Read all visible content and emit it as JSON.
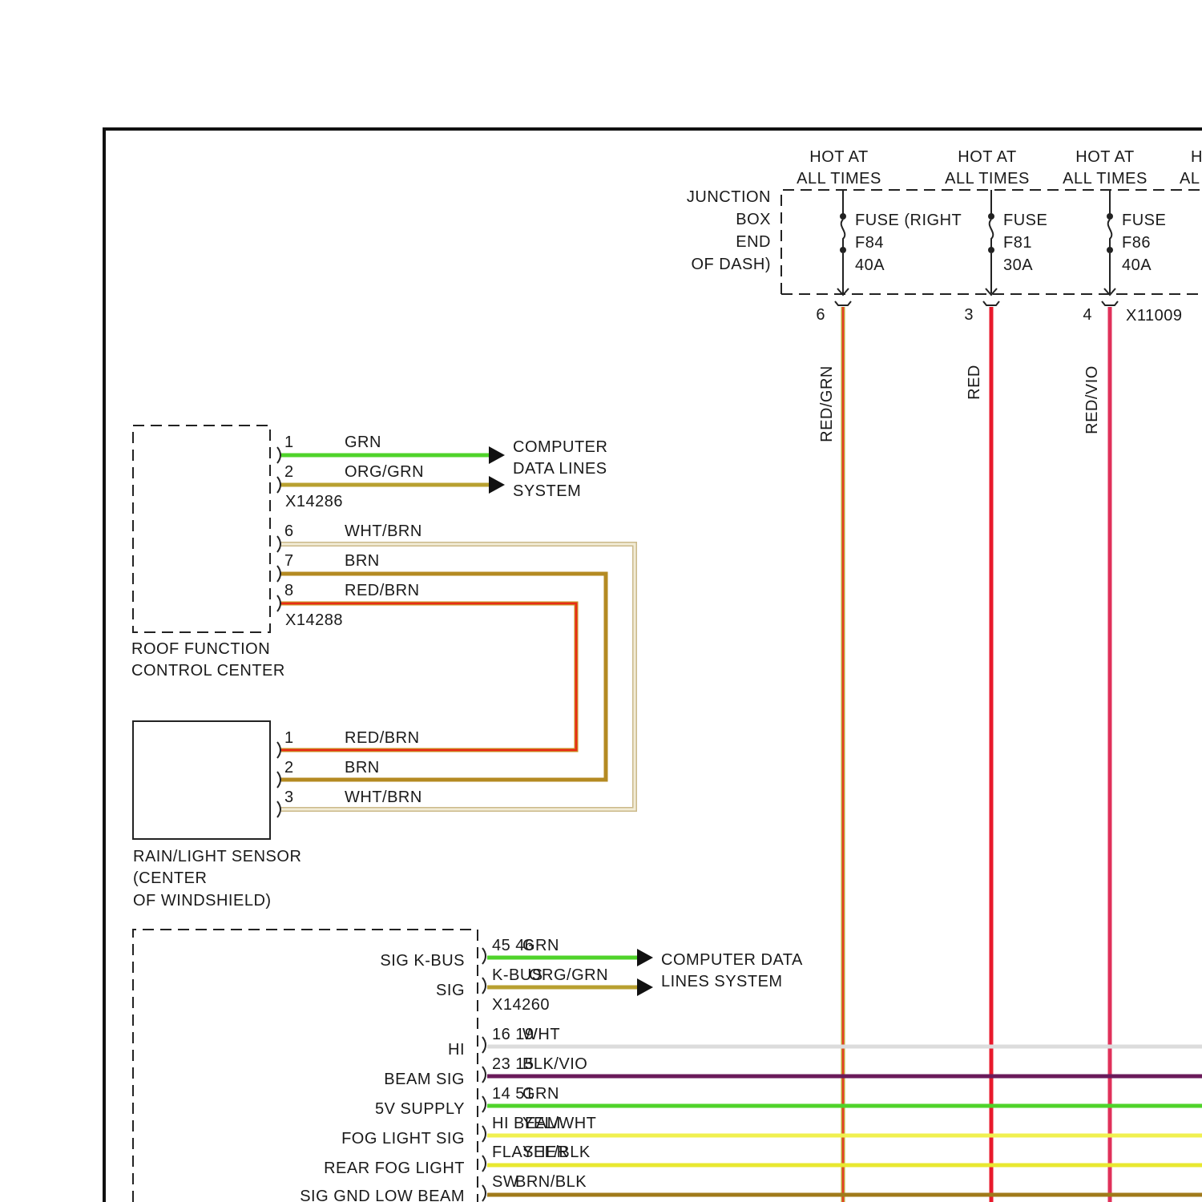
{
  "colors": {
    "GRN": "#4fd32a",
    "ORG/GRN": "#b8a030",
    "WHT/BRN": "#ece3c0",
    "BRN": "#b48a22",
    "RED/BRN": "#e8301a",
    "RED/GRN": "#c88a2a",
    "RED": "#e8192c",
    "RED/VIO": "#e0305a",
    "WHT": "#dcdcdc",
    "BLK/VIO": "#6a1a5a",
    "YEL/WHT": "#f0f050",
    "YEL/BLK": "#e8e830",
    "BRN/BLK": "#a07a1a"
  },
  "junction_box": {
    "label": [
      "JUNCTION",
      "BOX",
      "END",
      "OF DASH)"
    ],
    "connector": "X11009",
    "fuses": [
      {
        "hot": [
          "HOT AT",
          "ALL TIMES"
        ],
        "name": [
          "FUSE (RIGHT",
          "F84",
          "40A"
        ],
        "pin": "6",
        "wire": "RED/GRN"
      },
      {
        "hot": [
          "HOT AT",
          "ALL TIMES"
        ],
        "name": [
          "FUSE",
          "F81",
          "30A"
        ],
        "pin": "3",
        "wire": "RED"
      },
      {
        "hot": [
          "HOT AT",
          "ALL TIMES"
        ],
        "name": [
          "FUSE",
          "F86",
          "40A"
        ],
        "pin": "4",
        "wire": "RED/VIO"
      }
    ],
    "cut_hot": [
      "H",
      "AL"
    ]
  },
  "roof_module": {
    "label": [
      "ROOF FUNCTION",
      "CONTROL CENTER"
    ],
    "connector_a": "X14286",
    "connector_b": "X14288",
    "pins_a": [
      {
        "pin": "1",
        "wire": "GRN"
      },
      {
        "pin": "2",
        "wire": "ORG/GRN"
      }
    ],
    "pins_b": [
      {
        "pin": "6",
        "wire": "WHT/BRN"
      },
      {
        "pin": "7",
        "wire": "BRN"
      },
      {
        "pin": "8",
        "wire": "RED/BRN"
      }
    ],
    "destination": [
      "COMPUTER",
      "DATA LINES",
      "SYSTEM"
    ]
  },
  "rain_sensor": {
    "label": [
      "RAIN/LIGHT SENSOR",
      "(CENTER",
      "OF WINDSHIELD)"
    ],
    "pins": [
      {
        "pin": "1",
        "wire": "RED/BRN"
      },
      {
        "pin": "2",
        "wire": "BRN"
      },
      {
        "pin": "3",
        "wire": "WHT/BRN"
      }
    ]
  },
  "lower_module": {
    "connector": "X14260",
    "destination": [
      "COMPUTER DATA",
      "LINES SYSTEM"
    ],
    "left_labels": [
      "SIG K-BUS",
      "SIG",
      "HI",
      "BEAM SIG",
      "5V SUPPLY",
      "FOG LIGHT SIG",
      "REAR FOG LIGHT",
      "SIG GND LOW BEAM"
    ],
    "rows": [
      {
        "pins": "45 46",
        "func": "",
        "wire": "GRN",
        "color": "GRN",
        "arrow": true
      },
      {
        "pins": "",
        "func": "K-BUS",
        "wire": "ORG/GRN",
        "color": "ORG/GRN",
        "arrow": true
      },
      {
        "pins": "16 19",
        "func": "",
        "wire": "WHT",
        "color": "WHT",
        "arrow": false
      },
      {
        "pins": "23 15",
        "func": "",
        "wire": "BLK/VIO",
        "color": "BLK/VIO",
        "arrow": false
      },
      {
        "pins": "14 51",
        "func": "",
        "wire": "GRN",
        "color": "GRN",
        "arrow": false
      },
      {
        "pins": "",
        "func": "HI BEAM",
        "wire": "YEL/WHT",
        "color": "YEL/WHT",
        "arrow": false
      },
      {
        "pins": "",
        "func": "FLASHER",
        "wire": "YEL/BLK",
        "color": "YEL/BLK",
        "arrow": false
      },
      {
        "pins": "",
        "func": "SW",
        "wire": "BRN/BLK",
        "color": "BRN/BLK",
        "arrow": false
      }
    ]
  }
}
